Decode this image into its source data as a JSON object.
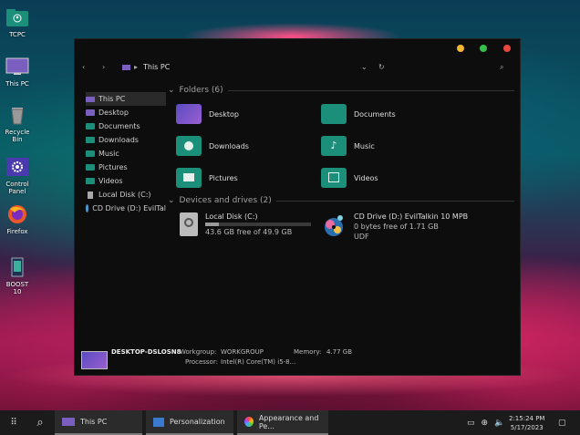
{
  "desktop": {
    "icons": [
      {
        "label": "TCPC"
      },
      {
        "label": "This PC"
      },
      {
        "label": "Recycle Bin"
      },
      {
        "label": "Control Panel"
      },
      {
        "label": "Firefox"
      },
      {
        "label": "BOOST 10"
      }
    ]
  },
  "window": {
    "address": "This PC",
    "sidebar": [
      {
        "label": "This PC"
      },
      {
        "label": "Desktop"
      },
      {
        "label": "Documents"
      },
      {
        "label": "Downloads"
      },
      {
        "label": "Music"
      },
      {
        "label": "Pictures"
      },
      {
        "label": "Videos"
      },
      {
        "label": "Local Disk (C:)"
      },
      {
        "label": "CD Drive (D:) EvilTal"
      }
    ],
    "folders_header": "Folders (6)",
    "folders": [
      {
        "label": "Desktop"
      },
      {
        "label": "Documents"
      },
      {
        "label": "Downloads"
      },
      {
        "label": "Music"
      },
      {
        "label": "Pictures"
      },
      {
        "label": "Videos"
      }
    ],
    "drives_header": "Devices and drives (2)",
    "drives": [
      {
        "name": "Local Disk (C:)",
        "free": "43.6 GB free of 49.9 GB",
        "used_fraction": 0.13
      },
      {
        "name": "CD Drive (D:) EvilTalkin 10 MPB",
        "free": "0 bytes free of 1.71 GB",
        "fs": "UDF"
      }
    ],
    "status": {
      "computer": "DESKTOP-DSLOSN8",
      "workgroup_label": "Workgroup:",
      "workgroup": "WORKGROUP",
      "memory_label": "Memory:",
      "memory": "4.77 GB",
      "processor_label": "Processor:",
      "processor": "Intel(R) Core(TM) i5-8..."
    }
  },
  "taskbar": {
    "apps": [
      {
        "label": "This PC"
      },
      {
        "label": "Personalization"
      },
      {
        "label": "Appearance and Pe..."
      }
    ],
    "time": "2:15:24 PM",
    "date": "5/17/2023"
  },
  "colors": {
    "folder": "#1b8f7a",
    "close": "#e5483f",
    "min": "#f3b632",
    "max": "#35c04a"
  }
}
